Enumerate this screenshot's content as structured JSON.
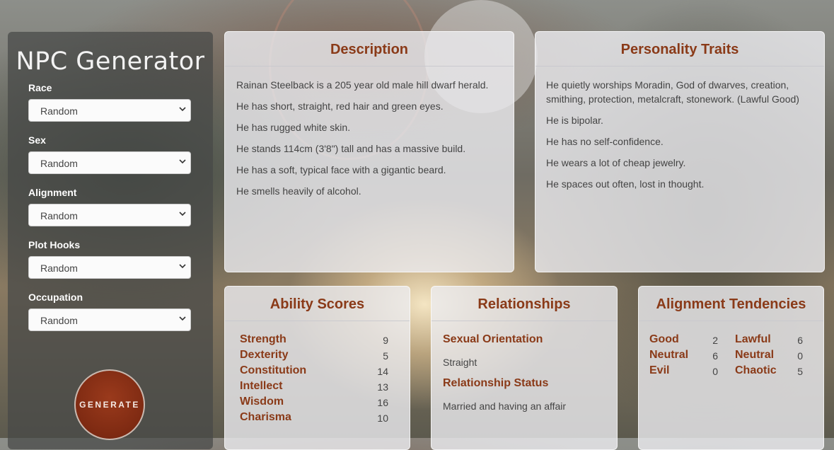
{
  "sidebar": {
    "title": "NPC Generator",
    "fields": [
      {
        "label": "Race",
        "value": "Random"
      },
      {
        "label": "Sex",
        "value": "Random"
      },
      {
        "label": "Alignment",
        "value": "Random"
      },
      {
        "label": "Plot Hooks",
        "value": "Random"
      },
      {
        "label": "Occupation",
        "value": "Random"
      }
    ],
    "generate_label": "GENERATE"
  },
  "description": {
    "title": "Description",
    "lines": [
      "Rainan Steelback is a 205 year old male hill dwarf herald.",
      "He has short, straight, red hair and green eyes.",
      "He has rugged white skin.",
      "He stands 114cm (3'8\") tall and has a massive build.",
      "He has a soft, typical face with a gigantic beard.",
      "He smells heavily of alcohol."
    ]
  },
  "personality": {
    "title": "Personality Traits",
    "lines": [
      "He quietly worships Moradin, God of dwarves, creation, smithing, protection, metalcraft, stonework. (Lawful Good)",
      "He is bipolar.",
      "He has no self-confidence.",
      "He wears a lot of cheap jewelry.",
      "He spaces out often, lost in thought."
    ]
  },
  "abilities": {
    "title": "Ability Scores",
    "items": [
      {
        "name": "Strength",
        "value": "9"
      },
      {
        "name": "Dexterity",
        "value": "5"
      },
      {
        "name": "Constitution",
        "value": "14"
      },
      {
        "name": "Intellect",
        "value": "13"
      },
      {
        "name": "Wisdom",
        "value": "16"
      },
      {
        "name": "Charisma",
        "value": "10"
      }
    ]
  },
  "relationships": {
    "title": "Relationships",
    "orientation_label": "Sexual Orientation",
    "orientation_value": "Straight",
    "status_label": "Relationship Status",
    "status_value": "Married and having an affair"
  },
  "alignment": {
    "title": "Alignment Tendencies",
    "left": [
      {
        "name": "Good",
        "value": "2"
      },
      {
        "name": "Neutral",
        "value": "6"
      },
      {
        "name": "Evil",
        "value": "0"
      }
    ],
    "right": [
      {
        "name": "Lawful",
        "value": "6"
      },
      {
        "name": "Neutral",
        "value": "0"
      },
      {
        "name": "Chaotic",
        "value": "5"
      }
    ]
  },
  "colors": {
    "accent": "#8a3a18",
    "button": "#7e2a12"
  }
}
